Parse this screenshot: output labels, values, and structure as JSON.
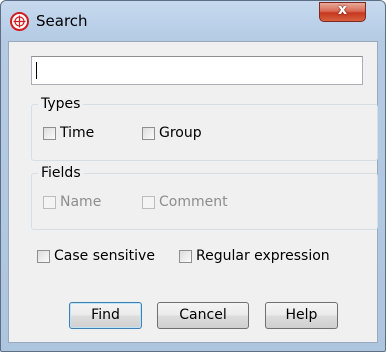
{
  "window": {
    "title": "Search",
    "close_glyph": "x",
    "app_icon": "target-globe-icon"
  },
  "search": {
    "value": ""
  },
  "types": {
    "title": "Types",
    "options": [
      {
        "label": "Time",
        "checked": false,
        "enabled": true
      },
      {
        "label": "Group",
        "checked": false,
        "enabled": true
      }
    ]
  },
  "fields": {
    "title": "Fields",
    "options": [
      {
        "label": "Name",
        "checked": false,
        "enabled": false
      },
      {
        "label": "Comment",
        "checked": false,
        "enabled": false
      }
    ]
  },
  "options": {
    "case_sensitive": "Case sensitive",
    "regular_expression": "Regular expression"
  },
  "buttons": {
    "find": "Find",
    "cancel": "Cancel",
    "help": "Help"
  },
  "colors": {
    "title_bar": "#b9cfe8",
    "close_button": "#c5381f",
    "dialog_background": "#f0f0f0",
    "app_icon_red": "#d01d20"
  }
}
